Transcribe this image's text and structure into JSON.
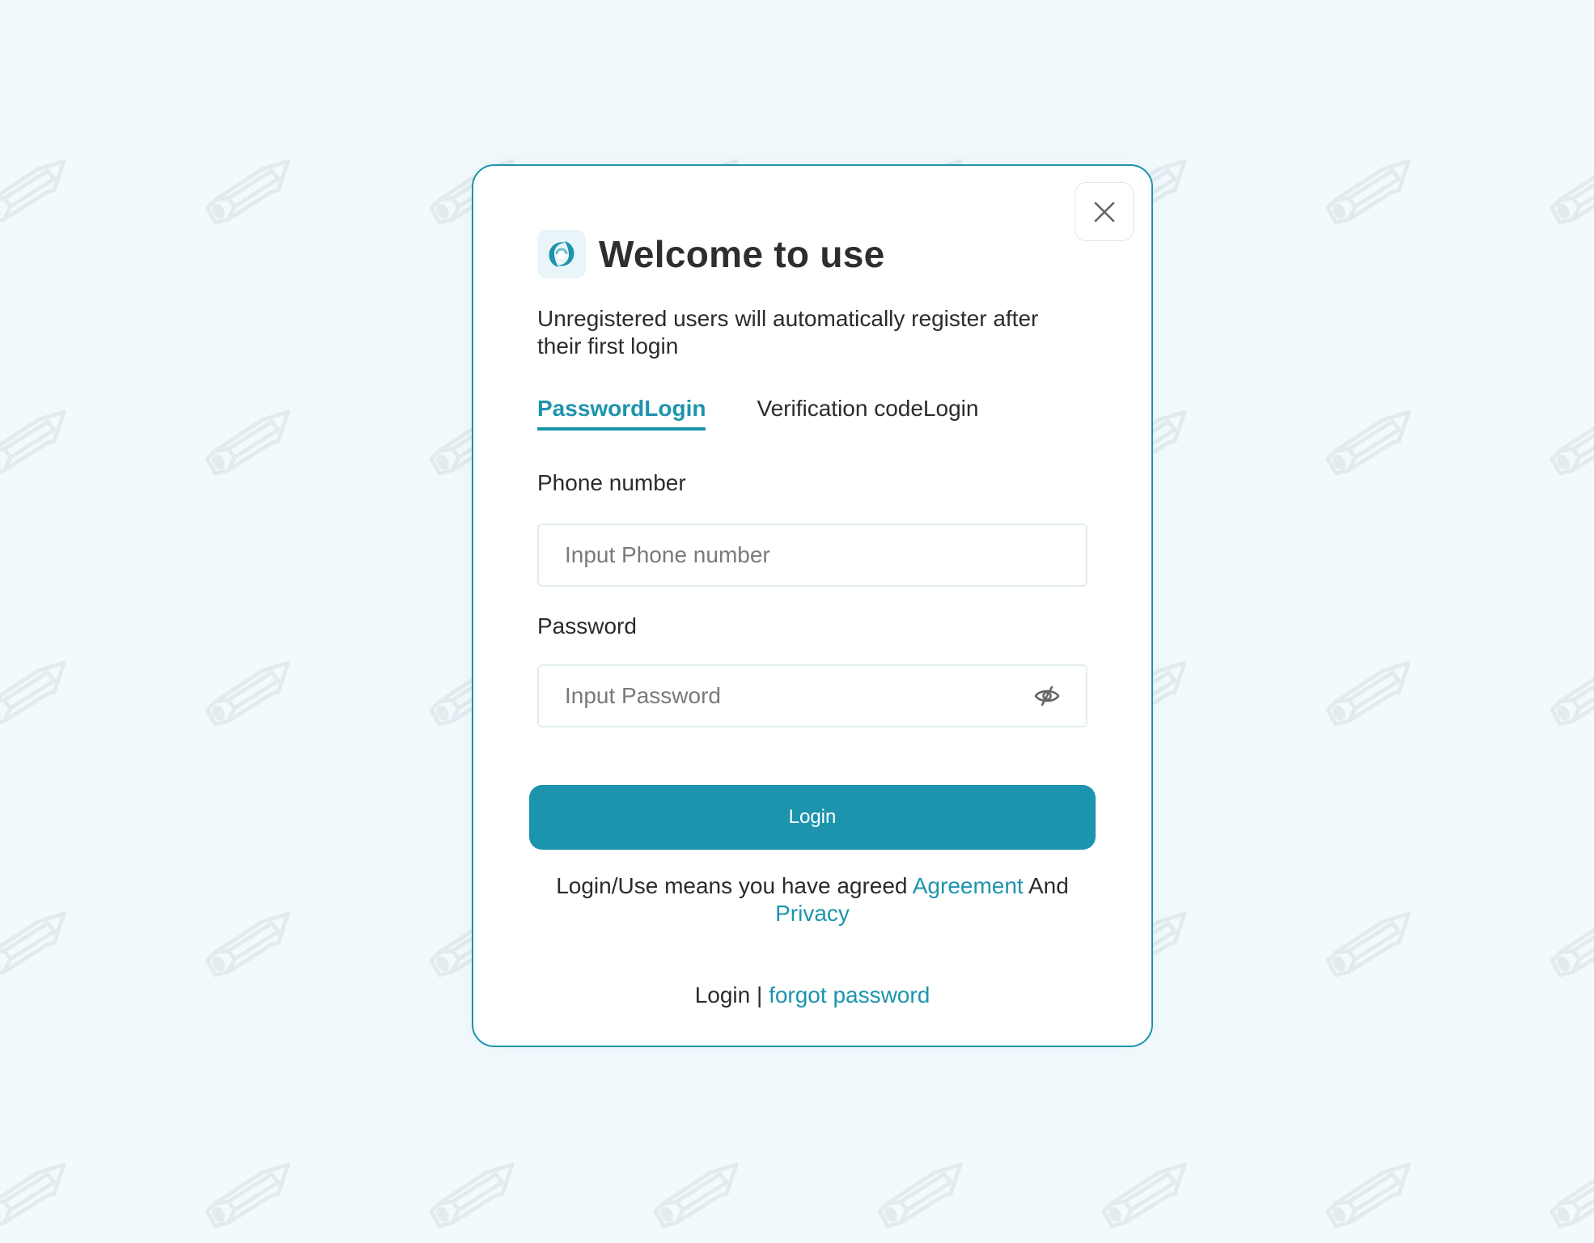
{
  "modal": {
    "title": "Welcome to use",
    "subtitle": "Unregistered users will automatically register after their first login",
    "logo_icon": "swirl-logo-icon",
    "close_icon": "close-icon"
  },
  "tabs": [
    {
      "label": "PasswordLogin",
      "active": true
    },
    {
      "label": "Verification codeLogin",
      "active": false
    }
  ],
  "form": {
    "phone": {
      "label": "Phone number",
      "placeholder": "Input Phone number",
      "value": ""
    },
    "password": {
      "label": "Password",
      "placeholder": "Input Password",
      "value": "",
      "toggle_icon": "eye-off-icon"
    },
    "submit_label": "Login"
  },
  "agreement": {
    "prefix": "Login/Use means you have agreed ",
    "agreement_link": "Agreement",
    "conjunction": " And ",
    "privacy_link": "Privacy"
  },
  "footer": {
    "login_label": "Login",
    "separator": " | ",
    "forgot_link": "forgot password"
  },
  "colors": {
    "accent": "#1D94AD",
    "background": "#F3FAFD",
    "text": "#2B2B2B",
    "placeholder": "#7A7A7A",
    "input_border": "#E2ECF1"
  },
  "background": {
    "pattern_icon": "pencil-icon"
  }
}
